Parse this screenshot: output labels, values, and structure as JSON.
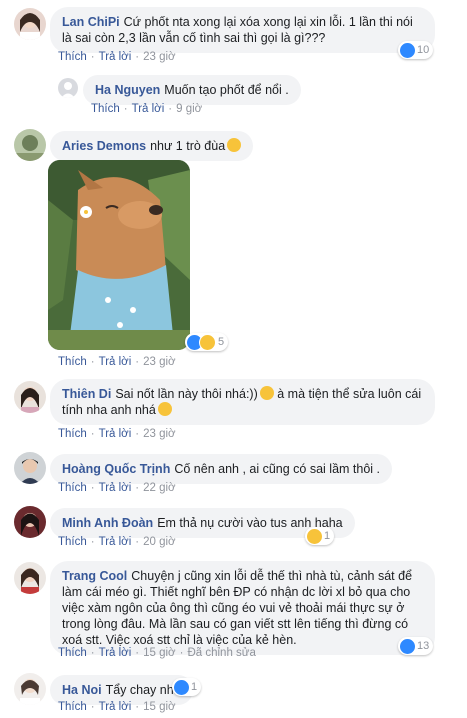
{
  "actions": {
    "like": "Thích",
    "reply": "Trả lời",
    "edited": "Đã chỉnh sửa"
  },
  "comments": [
    {
      "name": "Lan ChiPi",
      "text": "Cứ phốt nta xong lại xóa xong lại xin lỗi. 1 lần thi nói là sai còn 2,3 lần vẫn cố tình sai thì gọi là gì???",
      "time": "23 giờ",
      "reactions": "10"
    },
    {
      "name": "Ha Nguyen",
      "text": "Muốn tạo phốt để nổi .",
      "time": "9 giờ"
    },
    {
      "name": "Aries Demons",
      "text": "như 1 trò đùa",
      "time": "23 giờ",
      "reactions": "5"
    },
    {
      "name": "Thiên Di",
      "text": "Sai nốt lần này thôi nhá:))",
      "text2": "à mà tiện thể sửa luôn cái tính nha anh nhá",
      "time": "23 giờ"
    },
    {
      "name": "Hoàng Quốc Trịnh",
      "text": "Cố nên anh , ai cũng có sai lầm thôi .",
      "time": "22 giờ"
    },
    {
      "name": "Minh Anh Đoàn",
      "text": "Em thả nụ cười vào tus anh haha",
      "time": "20 giờ",
      "reactions": "1"
    },
    {
      "name": "Trang Cool",
      "text": "Chuyện j cũng xin lỗi dễ thế thì nhà tù, cảnh sát để làm cái méo gì. Thiết nghĩ bên ĐP có nhận dc lời xl bỏ qua cho việc xàm ngôn của ông thì cũng éo vui vẻ thoải mái thực sự ở trong lòng đâu. Mà lần sau có gan viết stt lên tiếng thì đừng có xoá stt. Việc xoá stt chỉ là việc của kẻ hèn.",
      "time": "15 giờ",
      "reactions": "13"
    },
    {
      "name": "Ha Noi",
      "text": "Tẩy chay nha",
      "time": "15 giờ",
      "reactions": "1"
    }
  ],
  "colors": {
    "link": "#385898",
    "bubble": "#f2f3f5",
    "muted": "#90949c",
    "like": "#2e89ff",
    "haha": "#f7c33a"
  }
}
